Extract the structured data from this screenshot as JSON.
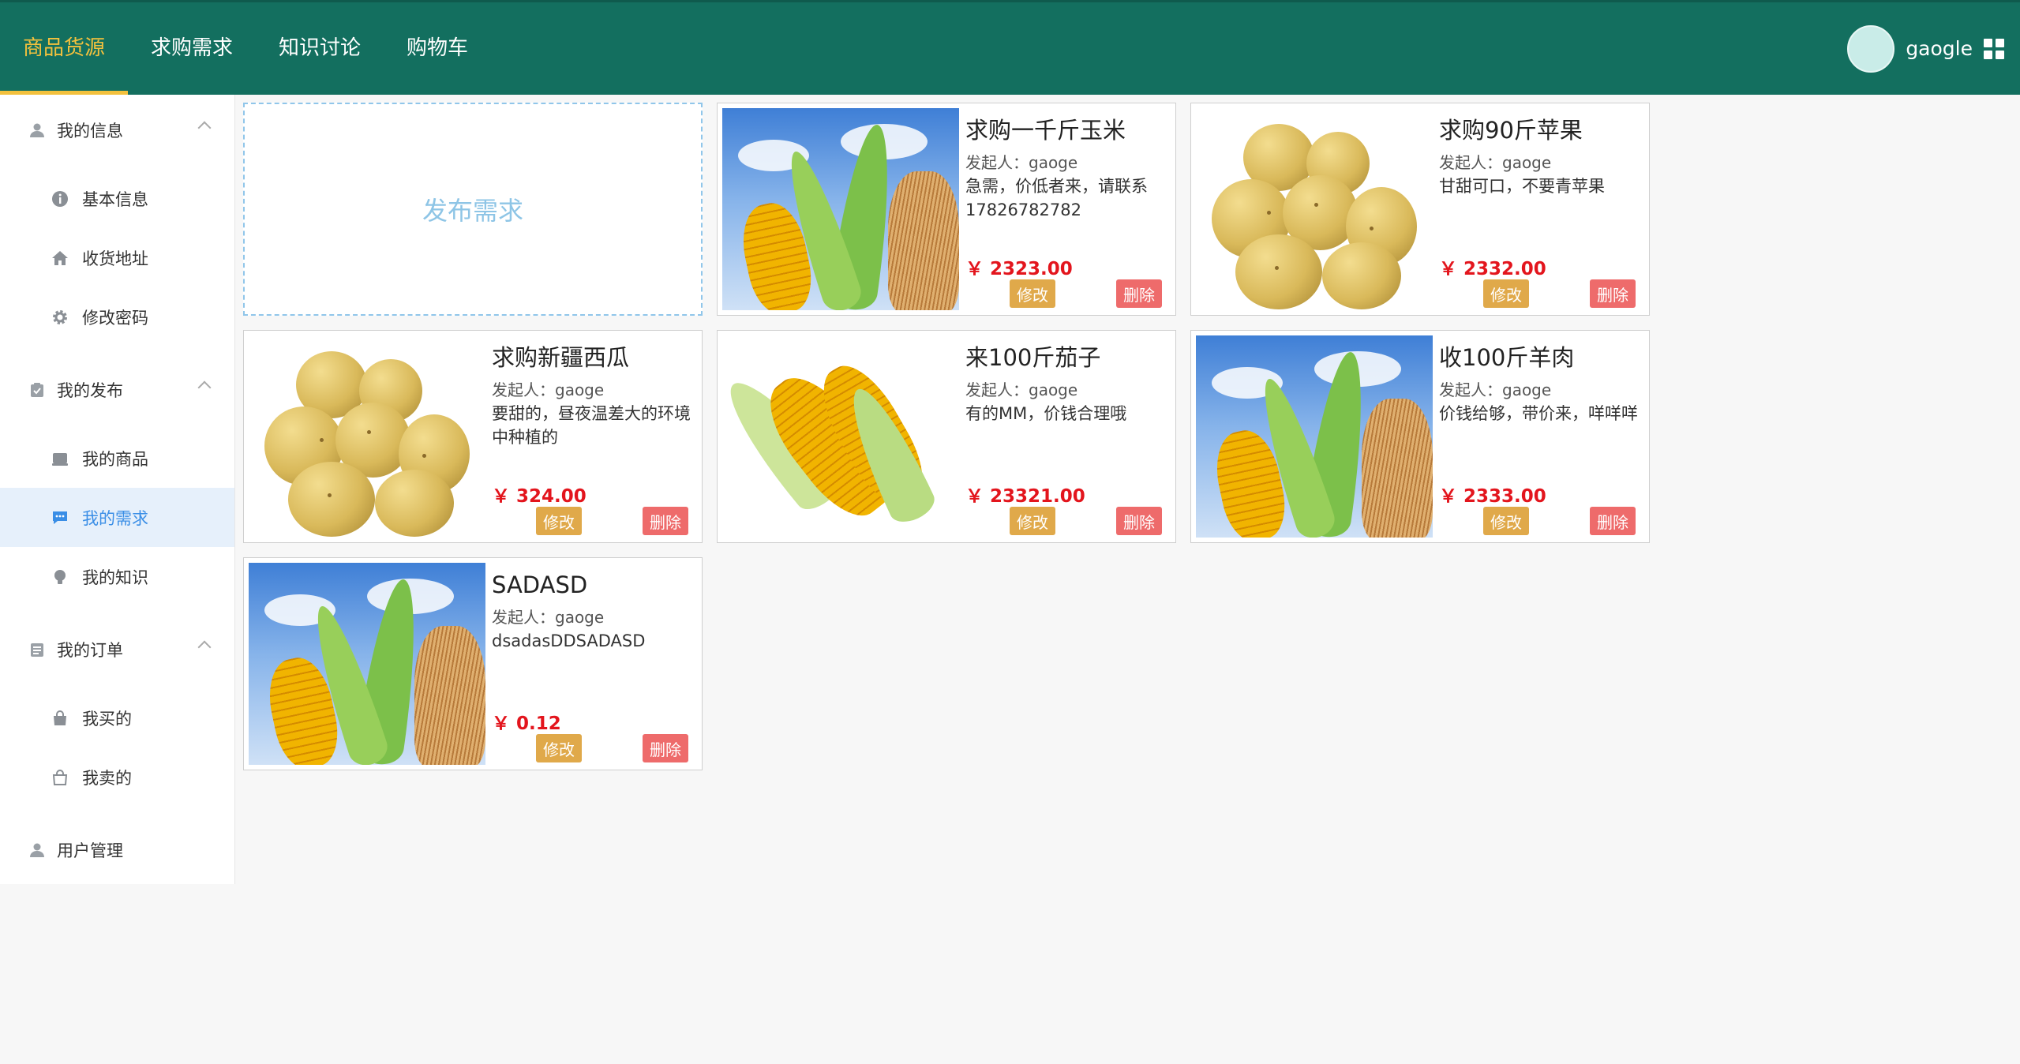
{
  "topnav": {
    "items": [
      {
        "label": "商品货源",
        "active": true
      },
      {
        "label": "求购需求",
        "active": false
      },
      {
        "label": "知识讨论",
        "active": false
      },
      {
        "label": "购物车",
        "active": false
      }
    ],
    "username": "gaogle",
    "colors": {
      "bar": "#136f5f",
      "active": "#f3c13d"
    }
  },
  "sidebar": {
    "groups": [
      {
        "label": "我的信息",
        "icon": "user-icon",
        "items": [
          {
            "label": "基本信息",
            "icon": "info-icon"
          },
          {
            "label": "收货地址",
            "icon": "home-icon"
          },
          {
            "label": "修改密码",
            "icon": "gear-icon"
          }
        ]
      },
      {
        "label": "我的发布",
        "icon": "clipboard-check-icon",
        "items": [
          {
            "label": "我的商品",
            "icon": "goods-icon"
          },
          {
            "label": "我的需求",
            "icon": "chat-icon",
            "active": true
          },
          {
            "label": "我的知识",
            "icon": "bulb-icon"
          }
        ]
      },
      {
        "label": "我的订单",
        "icon": "list-icon",
        "items": [
          {
            "label": "我买的",
            "icon": "bag-icon"
          },
          {
            "label": "我卖的",
            "icon": "bag-outline-icon"
          }
        ]
      }
    ],
    "admin": {
      "label": "用户管理",
      "icon": "user-admin-icon"
    }
  },
  "publish": {
    "label": "发布需求"
  },
  "cards": [
    {
      "title": "求购一千斤玉米",
      "poster": "发起人：gaoge",
      "desc": "急需，价低者来，请联系17826782782",
      "price": "￥ 2323.00",
      "image": "corn-sky"
    },
    {
      "title": "求购90斤苹果",
      "poster": "发起人：gaoge",
      "desc": "甘甜可口，不要青苹果",
      "price": "￥ 2332.00",
      "image": "potatoes"
    },
    {
      "title": "求购新疆西瓜",
      "poster": "发起人：gaoge",
      "desc": "要甜的，昼夜温差大的环境中种植的",
      "price": "￥ 324.00",
      "image": "potatoes"
    },
    {
      "title": "来100斤茄子",
      "poster": "发起人：gaoge",
      "desc": "有的MM，价钱合理哦",
      "price": "￥ 23321.00",
      "image": "corn-white"
    },
    {
      "title": "收100斤羊肉",
      "poster": "发起人：gaoge",
      "desc": "价钱给够，带价来，咩咩咩",
      "price": "￥ 2333.00",
      "image": "corn-sky"
    },
    {
      "title": "SADASD",
      "poster": "发起人：gaoge",
      "desc": "dsadasDDSADASD",
      "price": "￥ 0.12",
      "image": "corn-sky"
    }
  ],
  "card_actions": {
    "edit": "修改",
    "delete": "删除"
  },
  "colors": {
    "price": "#e3151d",
    "edit": "#e0a94a",
    "delete": "#ee6b6b",
    "active_sidebar": "#3a8ee6"
  }
}
